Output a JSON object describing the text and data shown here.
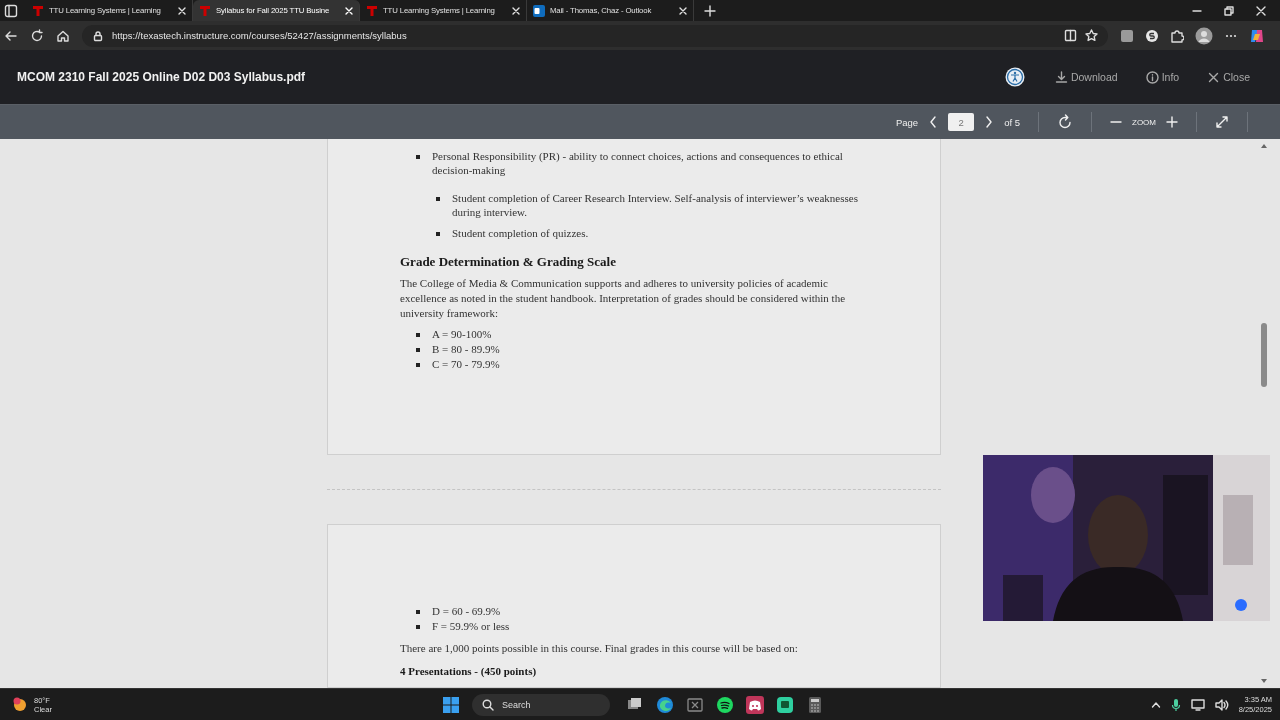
{
  "browser": {
    "tabs": [
      {
        "title": "TTU Learning Systems | Learning",
        "kind": "ttu",
        "selected": false
      },
      {
        "title": "Syllabus for Fall 2025 TTU Busine",
        "kind": "ttu",
        "selected": true
      },
      {
        "title": "TTU Learning Systems | Learning",
        "kind": "ttu",
        "selected": false
      },
      {
        "title": "Mail - Thomas, Chaz - Outlook",
        "kind": "outlook",
        "selected": false
      }
    ],
    "address": "https://texastech.instructure.com/courses/52427/assignments/syllabus"
  },
  "viewer": {
    "title": "MCOM 2310 Fall 2025 Online D02 D03 Syllabus.pdf",
    "actions": [
      {
        "kind": "download",
        "label": "Download"
      },
      {
        "kind": "info",
        "label": "Info"
      },
      {
        "kind": "close",
        "label": "Close"
      }
    ],
    "toolbar": {
      "page_label": "Page",
      "page": "2",
      "page_total": "of 5",
      "zoom_label": "ZOOM"
    }
  },
  "document": {
    "pages": [
      {
        "blocks": [
          {
            "kind": "list",
            "items": [
              {
                "text": "Personal Responsibility (PR) - ability to connect choices, actions and consequences to ethical decision-making",
                "children": [
                  {
                    "text": "Student completion of Career Research Interview. Self-analysis of interviewer’s weaknesses during interview."
                  },
                  {
                    "text": "Student completion of quizzes."
                  }
                ]
              }
            ]
          },
          {
            "kind": "heading",
            "text": "Grade Determination & Grading Scale"
          },
          {
            "kind": "paragraph",
            "text": "The College of Media & Communication supports and adheres to university policies of academic excellence as noted in the student handbook. Interpretation of grades should be considered within the university framework:"
          },
          {
            "kind": "compact-list",
            "items": [
              {
                "text": "A = 90-100%"
              },
              {
                "text": "B = 80 - 89.9%"
              },
              {
                "text": "C = 70 - 79.9%"
              }
            ]
          }
        ]
      },
      {
        "blocks": [
          {
            "kind": "compact-list",
            "items": [
              {
                "text": "D = 60 - 69.9%"
              },
              {
                "text": "F = 59.9% or less"
              }
            ]
          },
          {
            "kind": "paragraph",
            "text": "There are 1,000 points possible in this course. Final grades in this course will be based on:"
          },
          {
            "kind": "bold-paragraph",
            "text": "4 Presentations - (450 points)"
          }
        ]
      }
    ]
  },
  "taskbar": {
    "weather": {
      "temperature": "80°F",
      "condition": "Clear"
    },
    "search": {
      "placeholder": "Search"
    },
    "apps": [
      {
        "kind": "files"
      },
      {
        "kind": "edge"
      },
      {
        "kind": "excel"
      },
      {
        "kind": "spotify"
      },
      {
        "kind": "discord"
      },
      {
        "kind": "chat"
      },
      {
        "kind": "calculator"
      }
    ],
    "time": "3:35 AM",
    "date": "8/25/2025"
  }
}
